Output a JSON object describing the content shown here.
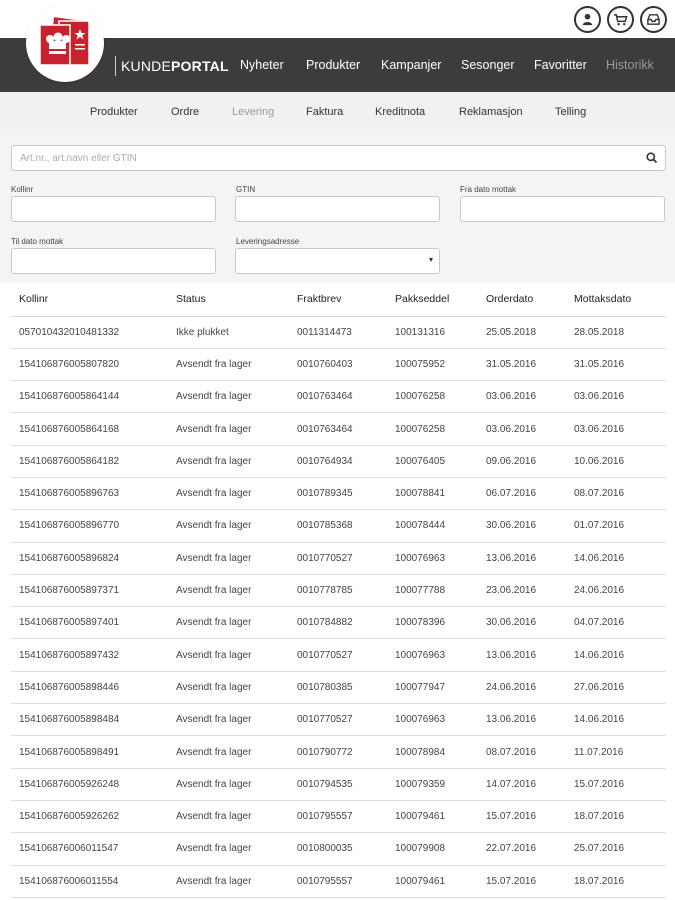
{
  "header": {
    "brand_part1": "KUNDE",
    "brand_part2": "PORTAL",
    "icons": [
      "user-icon",
      "cart-icon",
      "inbox-icon"
    ]
  },
  "main_nav": [
    "Nyheter",
    "Produkter",
    "Kampanjer",
    "Sesonger",
    "Favoritter",
    "Historikk"
  ],
  "sub_nav": {
    "items": [
      "Produkter",
      "Ordre",
      "Levering",
      "Faktura",
      "Kreditnota",
      "Reklamasjon",
      "Telling"
    ],
    "active": "Levering"
  },
  "filters": {
    "search_placeholder": "Art.nr., art.navn eller GTIN",
    "kollinr_label": "Kollinr",
    "gtin_label": "GTIN",
    "fra_dato_label": "Fra dato mottak",
    "til_dato_label": "Til dato mottak",
    "leveringsadresse_label": "Leveringsadresse"
  },
  "table": {
    "headers": [
      "Kollinr",
      "Status",
      "Fraktbrev",
      "Pakkseddel",
      "Orderdato",
      "Mottaksdato"
    ],
    "rows": [
      [
        "057010432010481332",
        "Ikke plukket",
        "0011314473",
        "100131316",
        "25.05.2018",
        "28.05.2018"
      ],
      [
        "154106876005807820",
        "Avsendt fra lager",
        "0010760403",
        "100075952",
        "31.05.2016",
        "31.05.2016"
      ],
      [
        "154106876005864144",
        "Avsendt fra lager",
        "0010763464",
        "100076258",
        "03.06.2016",
        "03.06.2016"
      ],
      [
        "154106876005864168",
        "Avsendt fra lager",
        "0010763464",
        "100076258",
        "03.06.2016",
        "03.06.2016"
      ],
      [
        "154106876005864182",
        "Avsendt fra lager",
        "0010764934",
        "100076405",
        "09.06.2016",
        "10.06.2016"
      ],
      [
        "154106876005896763",
        "Avsendt fra lager",
        "0010789345",
        "100078841",
        "06.07.2016",
        "08.07.2016"
      ],
      [
        "154106876005896770",
        "Avsendt fra lager",
        "0010785368",
        "100078444",
        "30.06.2016",
        "01.07.2016"
      ],
      [
        "154106876005896824",
        "Avsendt fra lager",
        "0010770527",
        "100076963",
        "13.06.2016",
        "14.06.2016"
      ],
      [
        "154106876005897371",
        "Avsendt fra lager",
        "0010778785",
        "100077788",
        "23.06.2016",
        "24.06.2016"
      ],
      [
        "154106876005897401",
        "Avsendt fra lager",
        "0010784882",
        "100078396",
        "30.06.2016",
        "04.07.2016"
      ],
      [
        "154106876005897432",
        "Avsendt fra lager",
        "0010770527",
        "100076963",
        "13.06.2016",
        "14.06.2016"
      ],
      [
        "154106876005898446",
        "Avsendt fra lager",
        "0010780385",
        "100077947",
        "24.06.2016",
        "27.06.2016"
      ],
      [
        "154106876005898484",
        "Avsendt fra lager",
        "0010770527",
        "100076963",
        "13.06.2016",
        "14.06.2016"
      ],
      [
        "154106876005898491",
        "Avsendt fra lager",
        "0010790772",
        "100078984",
        "08.07.2016",
        "11.07.2016"
      ],
      [
        "154106876005926248",
        "Avsendt fra lager",
        "0010794535",
        "100079359",
        "14.07.2016",
        "15.07.2016"
      ],
      [
        "154106876005926262",
        "Avsendt fra lager",
        "0010795557",
        "100079461",
        "15.07.2016",
        "18.07.2016"
      ],
      [
        "154106876006011547",
        "Avsendt fra lager",
        "0010800035",
        "100079908",
        "22.07.2016",
        "25.07.2016"
      ],
      [
        "154106876006011554",
        "Avsendt fra lager",
        "0010795557",
        "100079461",
        "15.07.2016",
        "18.07.2016"
      ]
    ]
  },
  "colors": {
    "nav_bg": "#3d3c3a",
    "subnav_bg": "#f2f1ef",
    "logo_red": "#c8232c"
  }
}
